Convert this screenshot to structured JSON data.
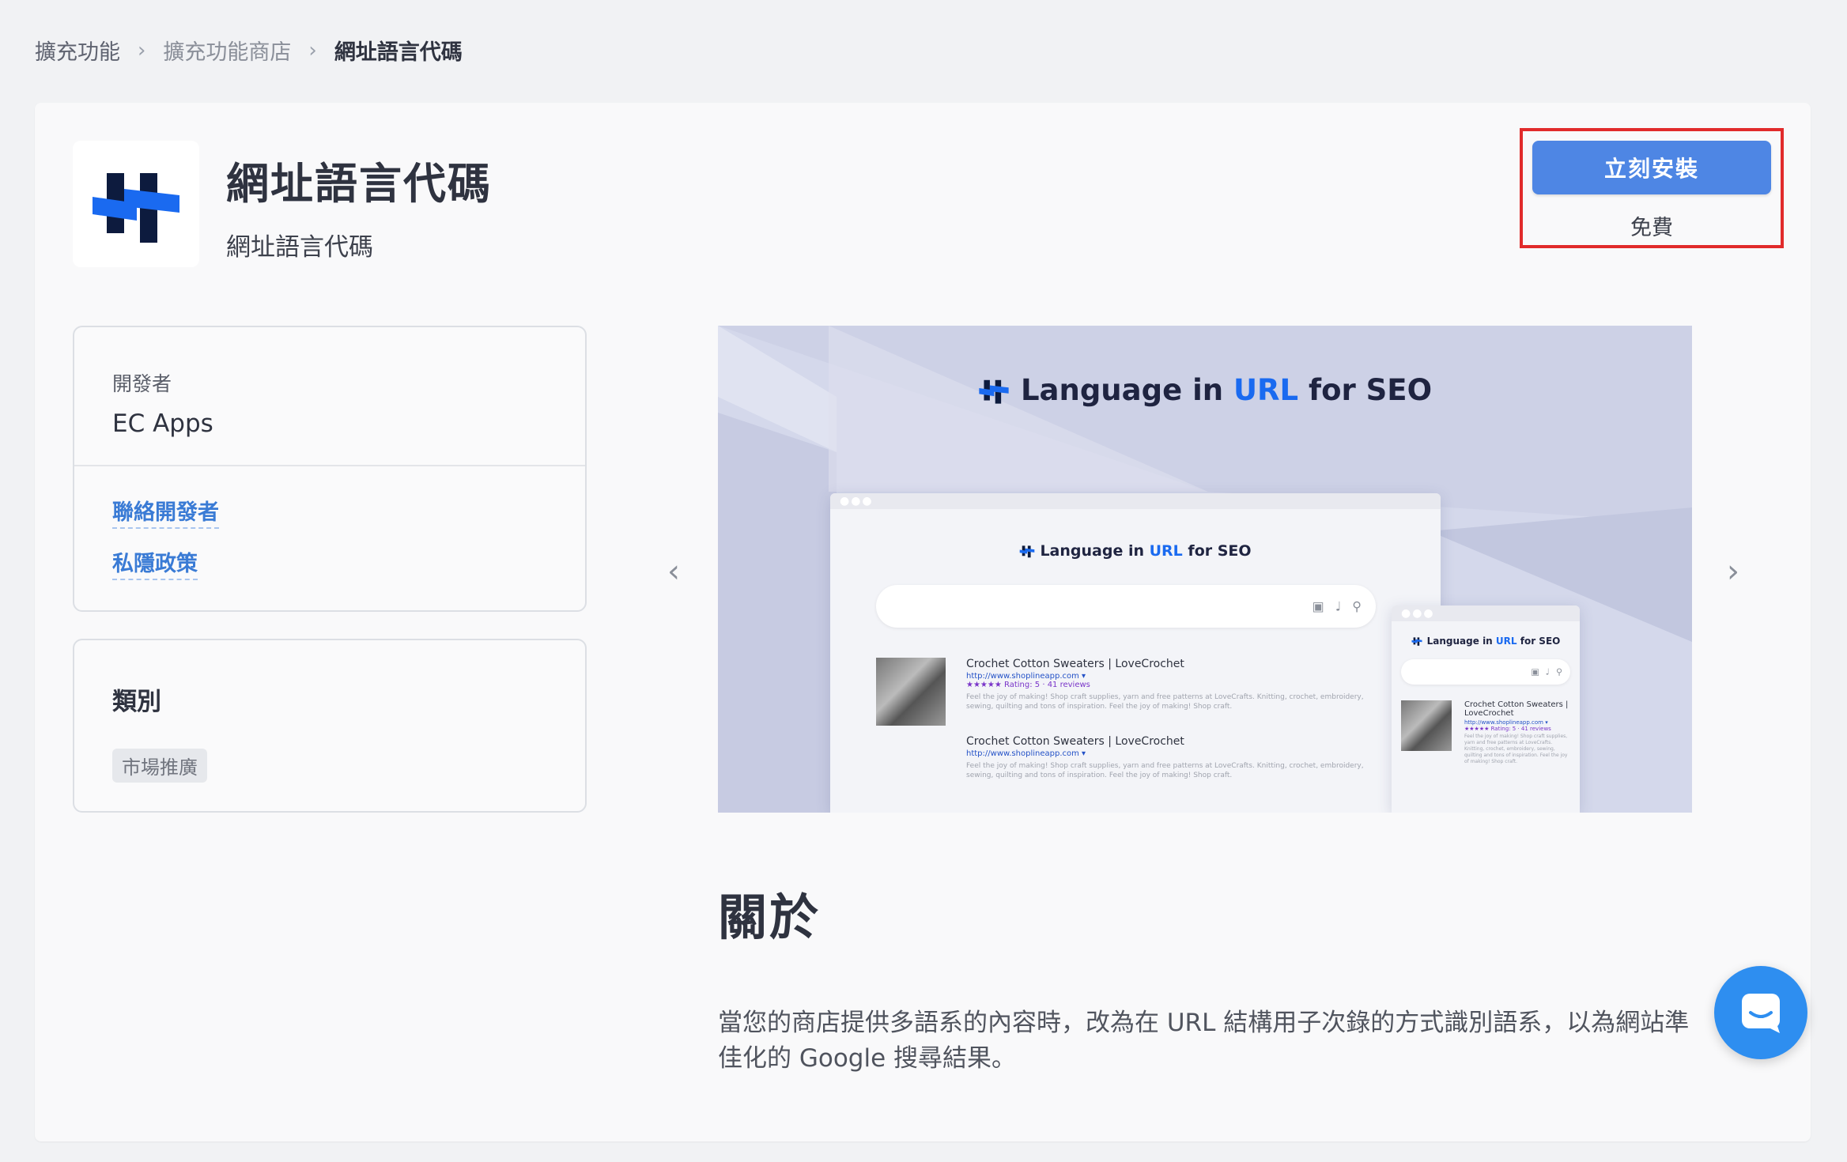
{
  "breadcrumb": {
    "items": [
      "擴充功能",
      "擴充功能商店",
      "網址語言代碼"
    ]
  },
  "app": {
    "title": "網址語言代碼",
    "subtitle": "網址語言代碼",
    "install_label": "立刻安裝",
    "price": "免費"
  },
  "developer": {
    "label": "開發者",
    "name": "EC Apps",
    "contact_link": "聯絡開發者",
    "privacy_link": "私隱政策"
  },
  "category": {
    "title": "類別",
    "tag": "市場推廣"
  },
  "banner": {
    "title_prefix": "Language in",
    "title_accent": "URL",
    "title_suffix": "for SEO",
    "results": [
      {
        "title": "Crochet Cotton Sweaters | LoveCrochet",
        "url": "http://www.shoplineapp.com ▾",
        "rating": "★★★★★ Rating: 5 · 41 reviews",
        "desc": "Feel the joy of making! Shop craft supplies, yarn and free patterns at LoveCrafts. Knitting, crochet, embroidery, sewing, quilting and tons of inspiration. Feel the joy of making! Shop craft."
      },
      {
        "title": "Crochet Cotton Sweaters | LoveCrochet",
        "url": "http://www.shoplineapp.com ▾",
        "desc": "Feel the joy of making! Shop craft supplies, yarn and free patterns at LoveCrafts. Knitting, crochet, embroidery, sewing, quilting and tons of inspiration. Feel the joy of making! Shop craft."
      }
    ],
    "mobile_result": {
      "title": "Crochet Cotton Sweaters | LoveCrochet",
      "url": "http://www.shoplineapp.com ▾",
      "rating": "★★★★★ Rating: 5 · 41 reviews",
      "desc": "Feel the joy of making! Shop craft supplies, yarn and free patterns at LoveCrafts. Knitting, crochet, embroidery, sewing, quilting and tons of inspiration. Feel the joy of making! Shop craft."
    }
  },
  "about": {
    "title": "關於",
    "description": "當您的商店提供多語系的內容時，改為在 URL 結構用子次錄的方式識別語系，以為網站準佳化的 Google 搜尋結果。"
  },
  "colors": {
    "install_button": "#4e86e4",
    "highlight_box": "#e12b2b",
    "link": "#3a7bd5",
    "chat_bubble": "#2e8ef0"
  }
}
